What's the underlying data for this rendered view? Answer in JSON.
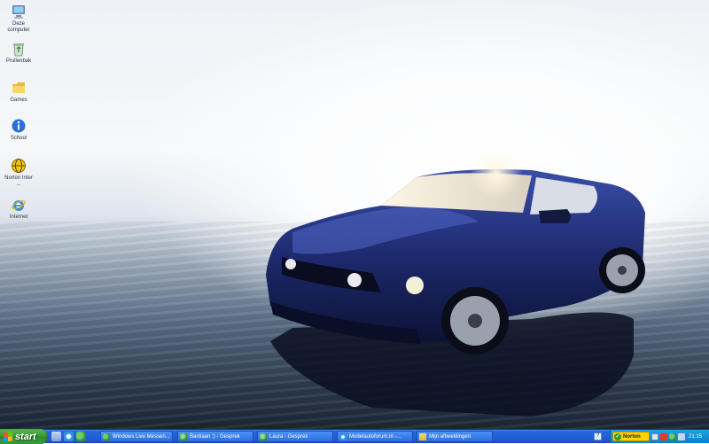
{
  "desktop": {
    "icons": [
      {
        "label": "Deze computer",
        "icon": "my-computer-icon"
      },
      {
        "label": "Prullenbak",
        "icon": "recycle-bin-icon"
      },
      {
        "label": "Games",
        "icon": "folder-icon"
      },
      {
        "label": "School",
        "icon": "info-icon"
      },
      {
        "label": "Norton Inter ...",
        "icon": "norton-globe-icon"
      },
      {
        "label": "Internet",
        "icon": "internet-explorer-icon"
      }
    ]
  },
  "taskbar": {
    "start_label": "start",
    "quick_launch": [
      "show-desktop-icon",
      "internet-explorer-icon",
      "messenger-icon"
    ],
    "buttons": [
      {
        "label": "Windows Live Messen...",
        "icon": "messenger-icon"
      },
      {
        "label": "Bastiaan :) - Gesprek",
        "icon": "conversation-icon"
      },
      {
        "label": "Laura - Gesprek",
        "icon": "conversation-icon"
      },
      {
        "label": "Modelautoforum.nl -...",
        "icon": "internet-explorer-icon"
      },
      {
        "label": "Mijn afbeeldingen",
        "icon": "folder-icon"
      }
    ],
    "tray": {
      "norton_label": "Norton",
      "clock": "21:15"
    }
  },
  "colors": {
    "taskbar_blue": "#245edb",
    "start_green": "#3a9b3a",
    "tray_blue": "#1290d8",
    "car_blue": "#1d2a6e"
  }
}
